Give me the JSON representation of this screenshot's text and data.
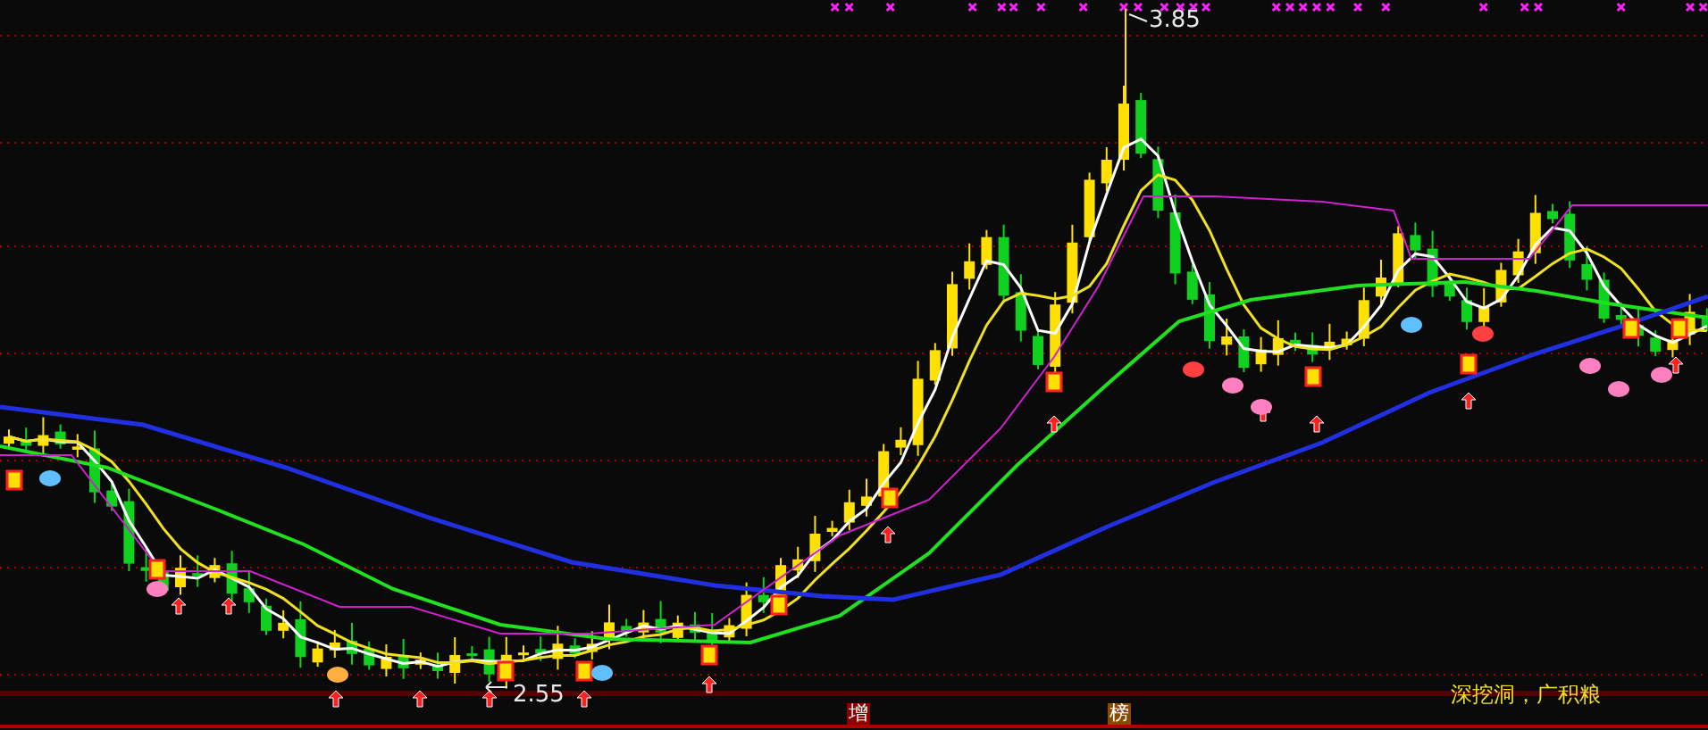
{
  "chart": {
    "high_label": "3.85",
    "low_label": "2.55"
  },
  "tags": [
    {
      "text": "增",
      "color": "#8b0000"
    },
    {
      "text": "榜",
      "color": "#8b4a00"
    }
  ],
  "slogan": "深挖洞，广积粮"
}
